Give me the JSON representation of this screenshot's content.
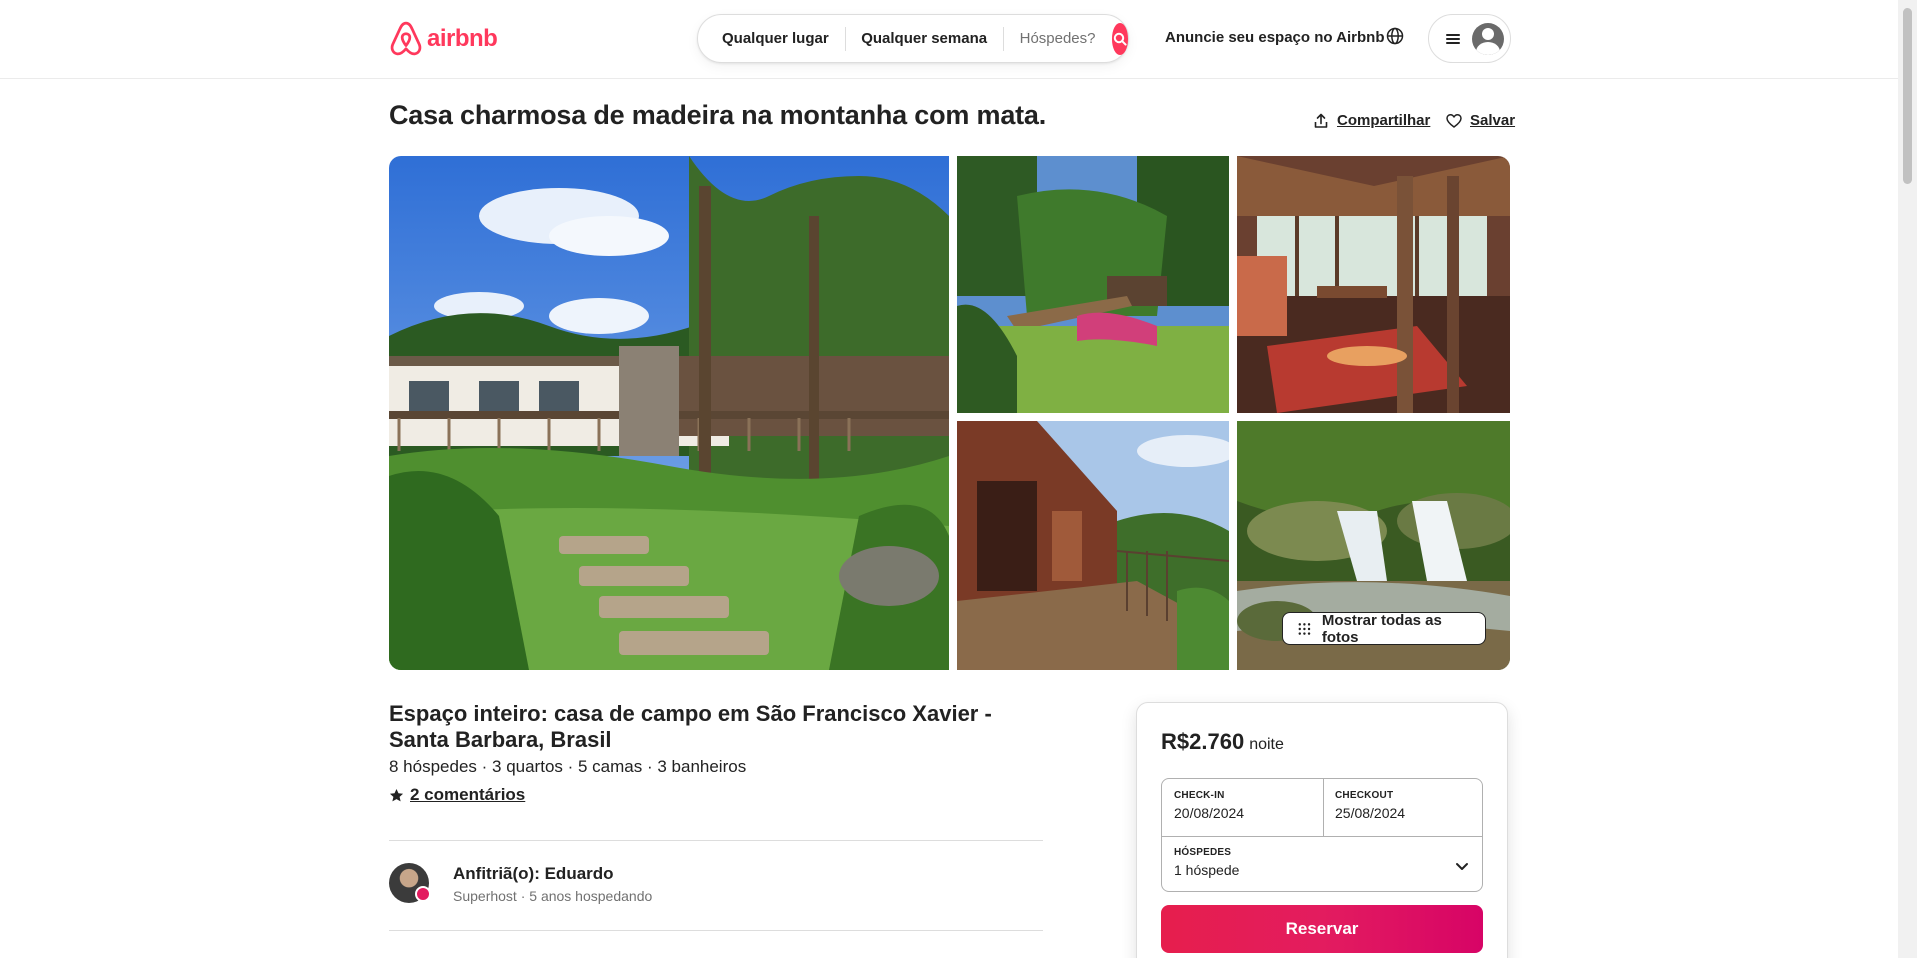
{
  "header": {
    "brand": "airbnb",
    "search": {
      "location": "Qualquer lugar",
      "week": "Qualquer semana",
      "guests_placeholder": "Hóspedes?"
    },
    "host_link": "Anuncie seu espaço no Airbnb",
    "icons": [
      "airbnb-logo",
      "search-icon",
      "globe-icon",
      "menu-icon",
      "user-avatar"
    ]
  },
  "listing": {
    "title": "Casa charmosa de madeira na montanha com mata.",
    "share_label": "Compartilhar",
    "save_label": "Salvar",
    "show_all_photos": "Mostrar todas as fotos",
    "subtitle": "Espaço inteiro: casa de campo em São Francisco Xavier - Santa Barbara, Brasil",
    "specs": "8 hóspedes · 3 quartos · 5 camas · 3 banheiros",
    "reviews_label": "2 comentários",
    "host_name": "Anfitriã(o): Eduardo",
    "host_meta": "Superhost · 5 anos hospedando"
  },
  "booking": {
    "price": "R$2.760",
    "price_unit": "noite",
    "checkin_label": "CHECK-IN",
    "checkin_value": "20/08/2024",
    "checkout_label": "CHECKOUT",
    "checkout_value": "25/08/2024",
    "guests_label": "HÓSPEDES",
    "guests_value": "1 hóspede",
    "reserve_label": "Reservar"
  },
  "colors": {
    "brand": "#ff385c",
    "reserve_gradient_start": "#e61e4d",
    "reserve_gradient_end": "#d70466"
  }
}
